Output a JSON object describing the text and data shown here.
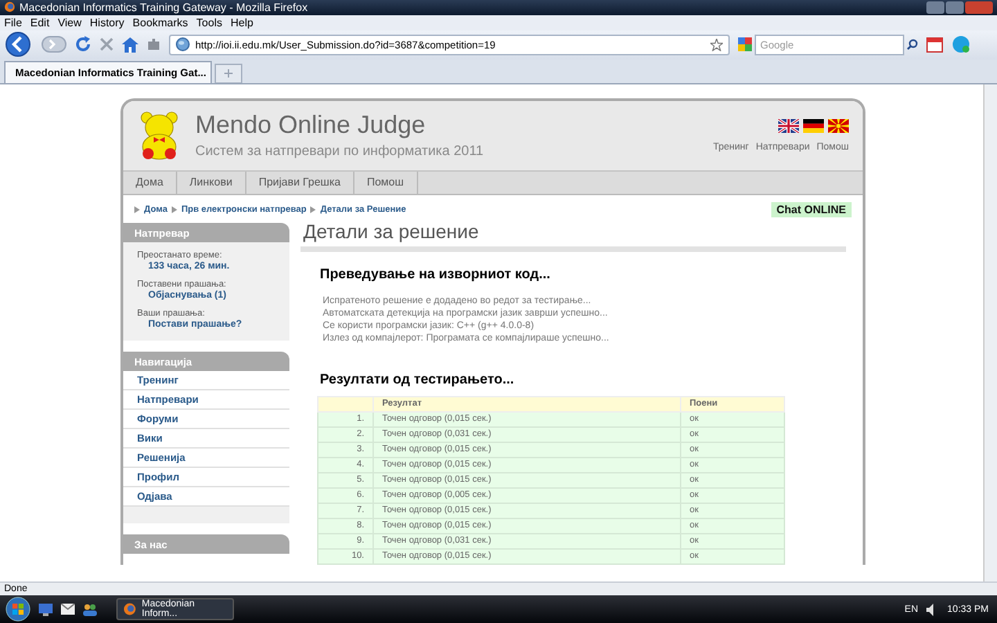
{
  "window": {
    "title": "Macedonian Informatics Training Gateway - Mozilla Firefox"
  },
  "menu": [
    "File",
    "Edit",
    "View",
    "History",
    "Bookmarks",
    "Tools",
    "Help"
  ],
  "address_bar": {
    "value": "http://ioi.ii.edu.mk/User_Submission.do?id=3687&competition=19"
  },
  "search": {
    "placeholder": "Google"
  },
  "tabs": [
    {
      "label": "Macedonian Informatics Training Gat...",
      "selected": true
    }
  ],
  "page": {
    "site_title": "Mendo Online Judge",
    "subtitle": "Систем за натпревари по информатика 2011",
    "languages": [
      {
        "kind": "uk"
      },
      {
        "kind": "de"
      },
      {
        "kind": "mk"
      }
    ],
    "top_links": [
      "Тренинг",
      "Натпревари",
      "Помош"
    ],
    "nav": [
      "Дома",
      "Линкови",
      "Пријави Грешка",
      "Помош"
    ],
    "breadcrumb": [
      "Дома",
      "Прв електронски натпревар",
      "Детали за Решение"
    ],
    "chat": "Chat ONLINE",
    "sidebar": {
      "contest": {
        "title": "Натпревар",
        "fields": [
          {
            "label": "Преостанато време:",
            "value": "133 часа, 26 мин."
          },
          {
            "label": "Поставени прашања:",
            "value": "Објаснувања (1)"
          },
          {
            "label": "Ваши прашања:",
            "value": "Постави прашање?"
          }
        ]
      },
      "navigation": {
        "title": "Навигација",
        "items": [
          "Тренинг",
          "Натпревари",
          "Форуми",
          "Вики",
          "Решенија",
          "Профил",
          "Одјава"
        ]
      },
      "about": {
        "title": "За нас"
      }
    },
    "main": {
      "title": "Детали за решение",
      "compile_heading": "Преведување на изворниот код...",
      "compile_log": [
        "Испратеното решение е додадено во редот за тестирање...",
        "Автоматската детекција на програмски јазик заврши успешно...",
        "Се користи програмски јазик: C++ (g++ 4.0.0-8)",
        "Излез од компајлерот: Програмата се компајлираше успешно..."
      ],
      "results_heading": "Резултати од тестирањето...",
      "table": {
        "columns": [
          "Резултат",
          "Поени"
        ],
        "rows": [
          {
            "number": "1.",
            "result": "Точен одговор (0,015 сек.)",
            "points": "ок"
          },
          {
            "number": "2.",
            "result": "Точен одговор (0,031 сек.)",
            "points": "ок"
          },
          {
            "number": "3.",
            "result": "Точен одговор (0,015 сек.)",
            "points": "ок"
          },
          {
            "number": "4.",
            "result": "Точен одговор (0,015 сек.)",
            "points": "ок"
          },
          {
            "number": "5.",
            "result": "Точен одговор (0,015 сек.)",
            "points": "ок"
          },
          {
            "number": "6.",
            "result": "Точен одговор (0,005 сек.)",
            "points": "ок"
          },
          {
            "number": "7.",
            "result": "Точен одговор (0,015 сек.)",
            "points": "ок"
          },
          {
            "number": "8.",
            "result": "Точен одговор (0,015 сек.)",
            "points": "ок"
          },
          {
            "number": "9.",
            "result": "Точен одговор (0,031 сек.)",
            "points": "ок"
          },
          {
            "number": "10.",
            "result": "Точен одговор (0,015 сек.)",
            "points": "ок"
          }
        ]
      }
    }
  },
  "status_bar": {
    "text": "Done"
  },
  "taskbar": {
    "task": "Macedonian Inform...",
    "language": "EN",
    "clock": "10:33 PM"
  }
}
